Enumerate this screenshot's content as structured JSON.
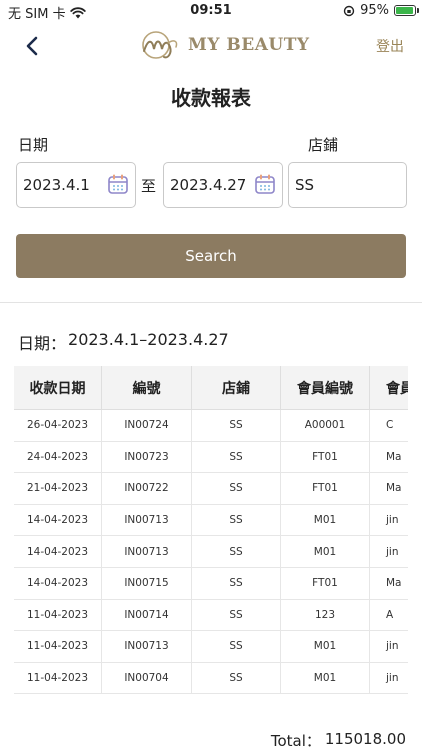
{
  "status_bar": {
    "carrier": "无 SIM 卡",
    "time": "09:51",
    "battery_percent": "95%",
    "battery_level": 0.95
  },
  "nav": {
    "logo_text": "MY BEAUTY",
    "logout_label": "登出"
  },
  "page_title": "收款報表",
  "form": {
    "date_label": "日期",
    "shop_label": "店鋪",
    "date_from": "2023.4.1",
    "to_label": "至",
    "date_to": "2023.4.27",
    "shop_value": "SS",
    "search_label": "Search"
  },
  "range": {
    "label": "日期：",
    "value": "2023.4.1–2023.4.27"
  },
  "table": {
    "headers": [
      "收款日期",
      "編號",
      "店鋪",
      "會員編號",
      "會員"
    ],
    "rows": [
      [
        "26-04-2023",
        "IN00724",
        "SS",
        "A00001",
        "C"
      ],
      [
        "24-04-2023",
        "IN00723",
        "SS",
        "FT01",
        "Ma"
      ],
      [
        "21-04-2023",
        "IN00722",
        "SS",
        "FT01",
        "Ma"
      ],
      [
        "14-04-2023",
        "IN00713",
        "SS",
        "M01",
        "jin"
      ],
      [
        "14-04-2023",
        "IN00713",
        "SS",
        "M01",
        "jin"
      ],
      [
        "14-04-2023",
        "IN00715",
        "SS",
        "FT01",
        "Ma"
      ],
      [
        "11-04-2023",
        "IN00714",
        "SS",
        "123",
        "A"
      ],
      [
        "11-04-2023",
        "IN00713",
        "SS",
        "M01",
        "jin"
      ],
      [
        "11-04-2023",
        "IN00704",
        "SS",
        "M01",
        "jin"
      ]
    ]
  },
  "total": {
    "label": "Total：",
    "value": "115018.00"
  },
  "colors": {
    "accent": "#8c7b61",
    "logo": "#9a8a6a",
    "logout": "#9a8558"
  },
  "icons": [
    "wifi-icon",
    "battery-icon",
    "back-arrow-icon",
    "calendar-icon"
  ]
}
